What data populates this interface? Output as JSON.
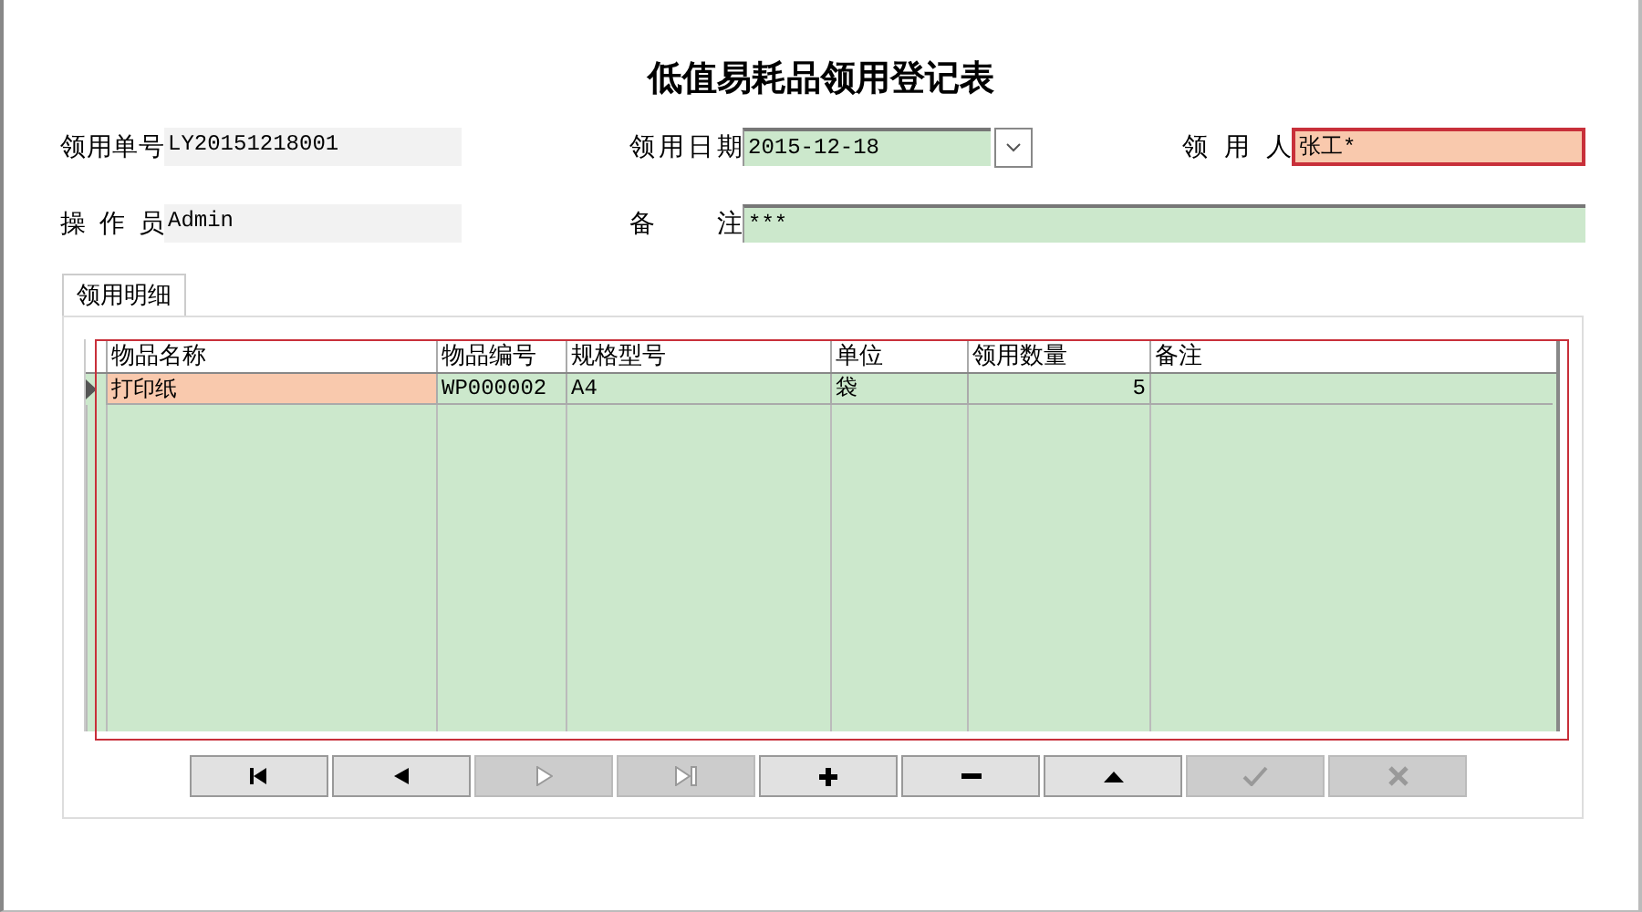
{
  "title": "低值易耗品领用登记表",
  "form_rows": [
    [
      {
        "label": "领用单号",
        "value": "LY20151218001",
        "kind": "readonly",
        "highlighted": false
      },
      {
        "label": "领用日期",
        "value": "2015-12-18",
        "kind": "date",
        "highlighted": false
      },
      {
        "label": "领用人",
        "value": "张工*",
        "kind": "text",
        "highlighted": true
      }
    ],
    [
      {
        "label": "操作员",
        "value": "Admin",
        "kind": "readonly",
        "highlighted": false
      },
      {
        "label": "备注",
        "value": "***",
        "kind": "text",
        "highlighted": false
      }
    ]
  ],
  "tabs": [
    {
      "label": "领用明细",
      "selected": true
    }
  ],
  "table": {
    "columns": [
      {
        "label": "物品名称",
        "kind": "text"
      },
      {
        "label": "物品编号",
        "kind": "text"
      },
      {
        "label": "规格型号",
        "kind": "text"
      },
      {
        "label": "单位",
        "kind": "text"
      },
      {
        "label": "领用数量",
        "kind": "number"
      },
      {
        "label": "备注",
        "kind": "text"
      }
    ],
    "rows": [
      {
        "current": true,
        "cells": [
          {
            "text": "打印纸",
            "selected": true
          },
          {
            "text": "WP000002",
            "selected": false
          },
          {
            "text": "A4",
            "selected": false
          },
          {
            "text": "袋",
            "selected": false
          },
          {
            "text": "5",
            "selected": false
          },
          {
            "text": "",
            "selected": false
          }
        ]
      }
    ]
  },
  "navigator": [
    {
      "kind": "first",
      "disabled": false
    },
    {
      "kind": "prior",
      "disabled": false
    },
    {
      "kind": "next",
      "disabled": true
    },
    {
      "kind": "last",
      "disabled": true
    },
    {
      "kind": "insert",
      "disabled": false
    },
    {
      "kind": "delete",
      "disabled": false
    },
    {
      "kind": "edit",
      "disabled": false
    },
    {
      "kind": "post",
      "disabled": true
    },
    {
      "kind": "cancel",
      "disabled": true
    }
  ]
}
